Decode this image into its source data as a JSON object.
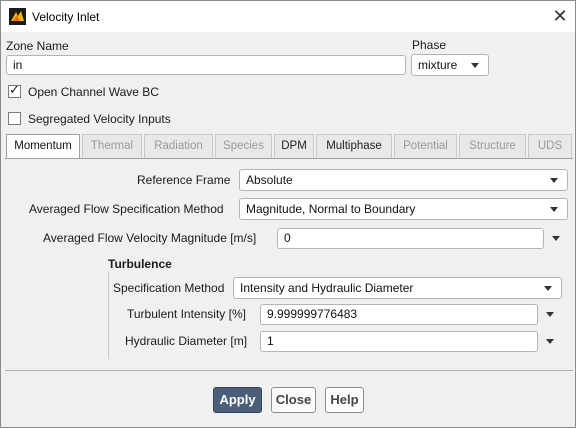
{
  "window": {
    "title": "Velocity Inlet",
    "icon": "fluent-app-icon"
  },
  "zone": {
    "label": "Zone Name",
    "value": "in"
  },
  "phase": {
    "label": "Phase",
    "selected": "mixture"
  },
  "checkboxes": {
    "open_channel": {
      "label": "Open Channel Wave BC",
      "checked": true
    },
    "segregated": {
      "label": "Segregated Velocity Inputs",
      "checked": false
    }
  },
  "tabs": [
    {
      "label": "Momentum",
      "state": "active"
    },
    {
      "label": "Thermal",
      "state": "disabled"
    },
    {
      "label": "Radiation",
      "state": "disabled"
    },
    {
      "label": "Species",
      "state": "disabled"
    },
    {
      "label": "DPM",
      "state": "enabled"
    },
    {
      "label": "Multiphase",
      "state": "enabled"
    },
    {
      "label": "Potential",
      "state": "disabled"
    },
    {
      "label": "Structure",
      "state": "disabled"
    },
    {
      "label": "UDS",
      "state": "disabled"
    }
  ],
  "momentum": {
    "reference_frame": {
      "label": "Reference Frame",
      "selected": "Absolute"
    },
    "averaged_flow_method": {
      "label": "Averaged Flow Specification Method",
      "selected": "Magnitude, Normal to Boundary"
    },
    "averaged_velocity": {
      "label": "Averaged Flow Velocity Magnitude [m/s]",
      "value": "0"
    },
    "turbulence": {
      "title": "Turbulence",
      "method": {
        "label": "Specification Method",
        "selected": "Intensity and Hydraulic Diameter"
      },
      "intensity": {
        "label": "Turbulent Intensity [%]",
        "value": "9.999999776483"
      },
      "diameter": {
        "label": "Hydraulic Diameter [m]",
        "value": "1"
      }
    }
  },
  "buttons": {
    "apply": "Apply",
    "close": "Close",
    "help": "Help"
  },
  "colors": {
    "primary_button": "#4b5f7a",
    "dialog_bg": "#f0f0f0"
  }
}
